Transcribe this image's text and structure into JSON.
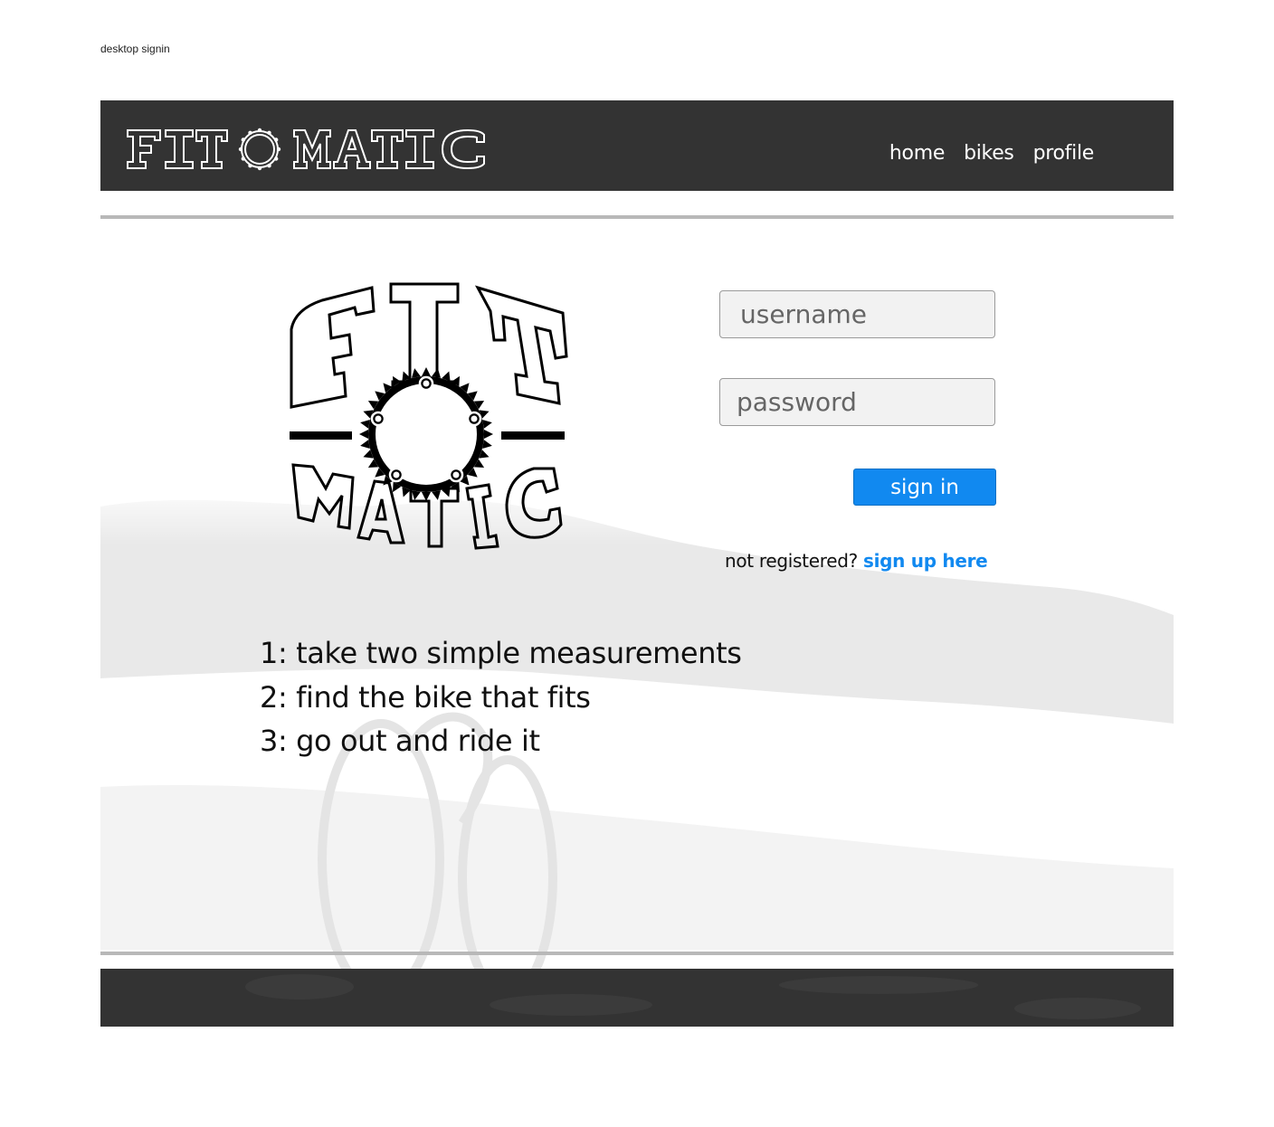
{
  "caption": "desktop signin",
  "brand": {
    "logo_name": "fit-o-matic-logo"
  },
  "nav": {
    "items": [
      {
        "label": "home"
      },
      {
        "label": "bikes"
      },
      {
        "label": "profile"
      }
    ]
  },
  "login": {
    "username_placeholder": "username",
    "password_placeholder": "password",
    "signin_label": "sign in",
    "not_registered": "not registered?",
    "signup_link": "sign up here"
  },
  "steps": [
    "1: take two simple measurements",
    "2: find the bike that fits",
    "3: go out and ride it"
  ],
  "colors": {
    "header_bg": "#333333",
    "accent": "#1189f0",
    "rule": "#b8b8b8"
  }
}
